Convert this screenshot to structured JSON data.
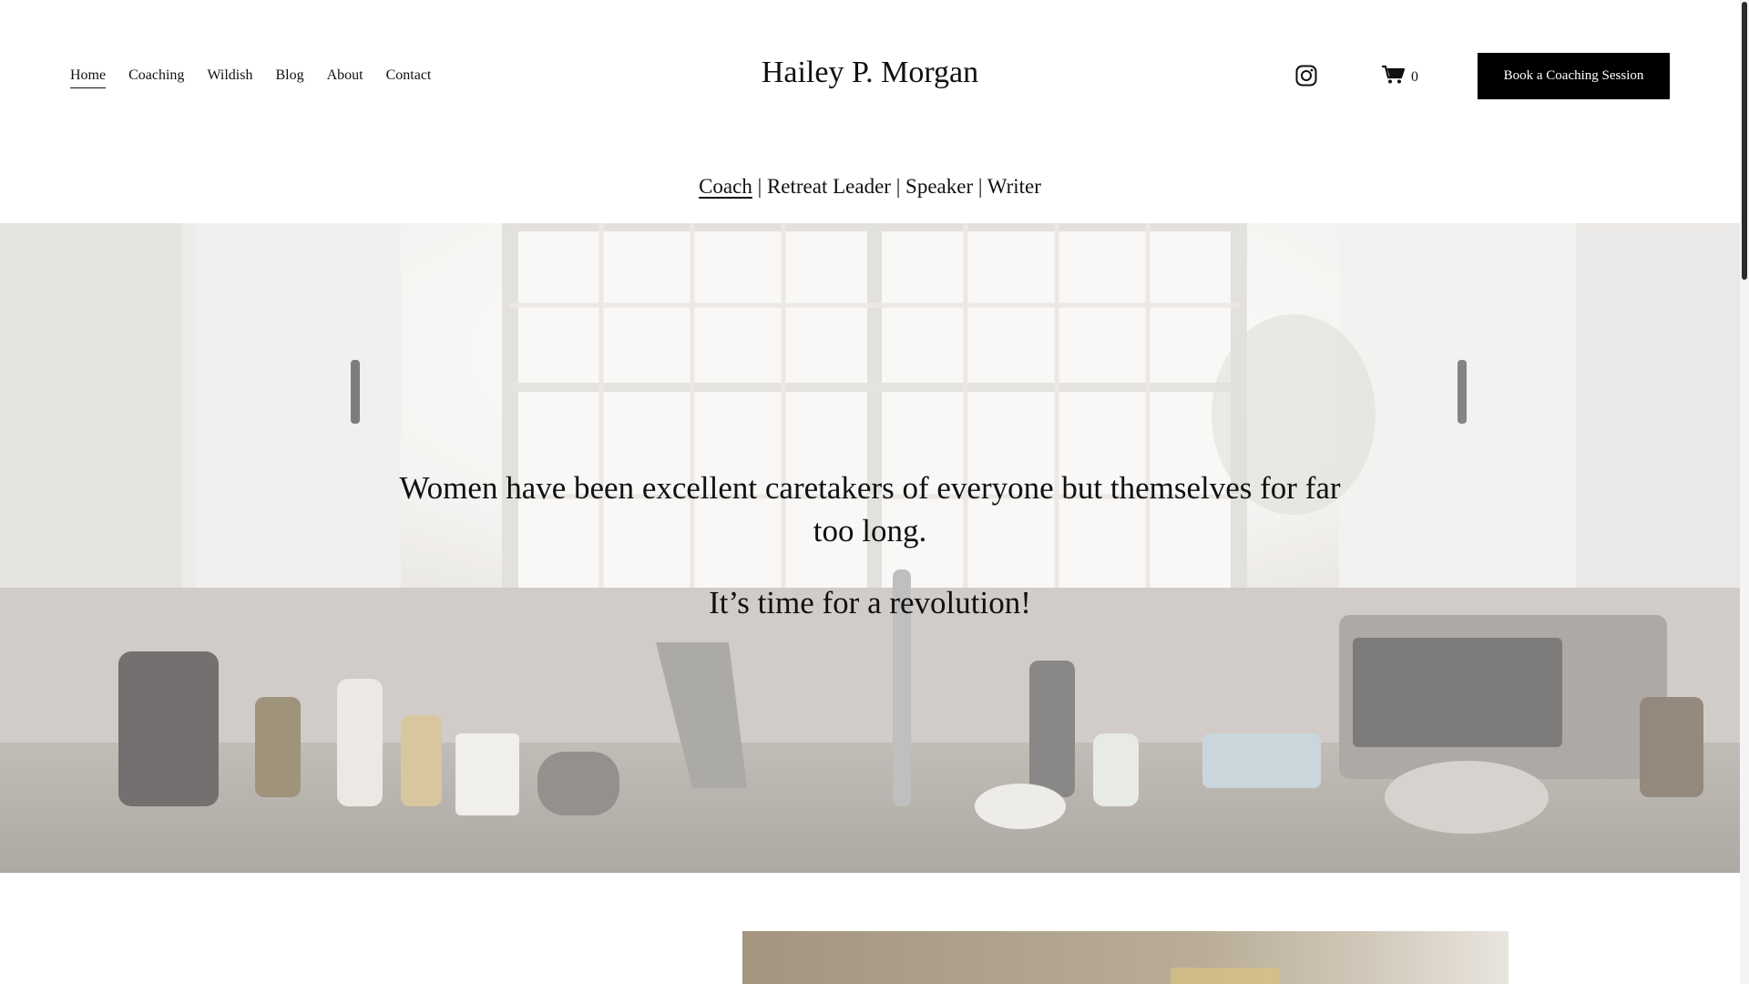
{
  "header": {
    "nav": [
      {
        "label": "Home",
        "active": true
      },
      {
        "label": "Coaching"
      },
      {
        "label": "Wildish"
      },
      {
        "label": "Blog"
      },
      {
        "label": "About"
      },
      {
        "label": "Contact"
      }
    ],
    "site_title": "Hailey P. Morgan",
    "instagram_icon": "instagram-icon",
    "cart_icon": "cart-icon",
    "cart_count": "0",
    "cta_label": "Book a Coaching Session"
  },
  "tagline": {
    "coach": "Coach",
    "rest": " | Retreat Leader | Speaker | Writer"
  },
  "hero": {
    "line1": "Women have been excellent caretakers of everyone but themselves for far too long.",
    "line2": "It’s time for a revolution!"
  },
  "colors": {
    "cta_bg": "#000000",
    "text": "#111111"
  }
}
